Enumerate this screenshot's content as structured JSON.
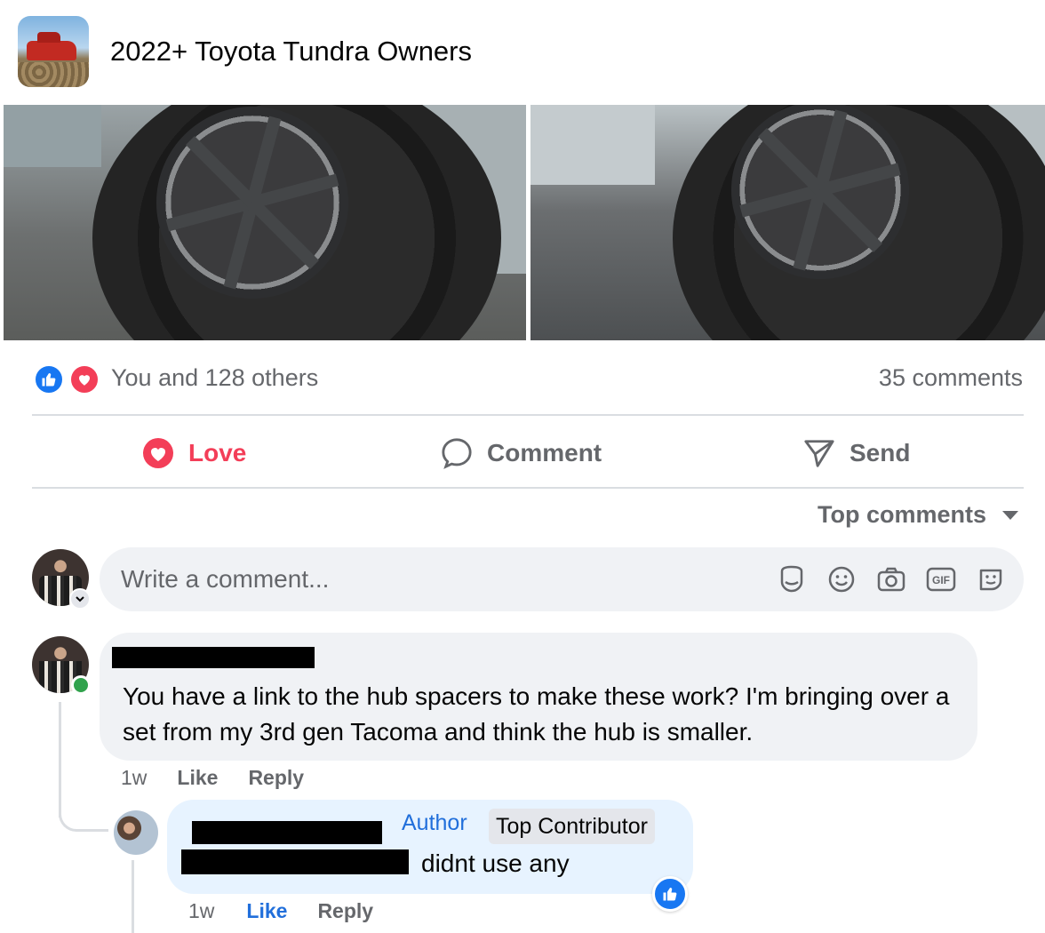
{
  "group": {
    "name": "2022+ Toyota Tundra Owners",
    "avatar_icon": "group-avatar"
  },
  "post": {
    "photos": [
      {
        "description_icon": "wheel-photo"
      },
      {
        "description_icon": "wheel-photo"
      }
    ]
  },
  "reactions": {
    "summary": "You and 128 others",
    "comments": "35 comments",
    "icons": [
      "like-icon",
      "love-icon"
    ],
    "colors": {
      "like": "#1877f2",
      "love": "#f33e58"
    }
  },
  "actions": {
    "love": "Love",
    "comment": "Comment",
    "send": "Send",
    "love_color": "#f33e58"
  },
  "sort": {
    "label": "Top comments"
  },
  "composer": {
    "placeholder": "Write a comment...",
    "icons": [
      "avatar-sticker-icon",
      "emoji-icon",
      "camera-icon",
      "gif-icon",
      "sticker-icon"
    ],
    "gif_label": "GIF"
  },
  "comments": [
    {
      "author_redacted": true,
      "text": "You have a link to the hub spacers to make these work? I'm bringing over a set from my 3rd gen Tacoma and think the hub is smaller.",
      "time": "1w",
      "like": "Like",
      "reply": "Reply",
      "online": true
    },
    {
      "author_redacted": true,
      "badges": [
        "Author",
        "Top Contributor"
      ],
      "text_visible": "didnt use any",
      "time": "1w",
      "like": "Like",
      "reply": "Reply",
      "liked": true,
      "accent": "#216fdb"
    }
  ]
}
